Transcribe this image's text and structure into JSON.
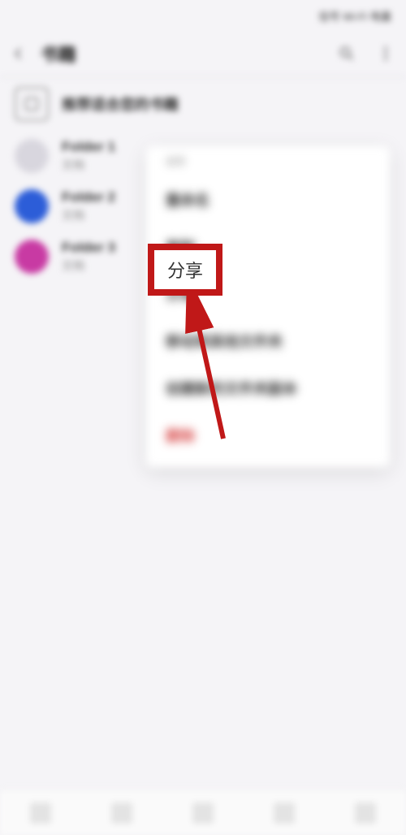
{
  "status": {
    "time_indicator": "",
    "right_icons": "信号 Wi-Fi 电量"
  },
  "header": {
    "title": "书籍"
  },
  "suggestion": {
    "text": "推荐适合您的书籍"
  },
  "list": [
    {
      "title": "Folder 1",
      "subtitle": "文档"
    },
    {
      "title": "Folder 2",
      "subtitle": "文档"
    },
    {
      "title": "Folder 3",
      "subtitle": "文档"
    }
  ],
  "context_menu": {
    "header": "选项",
    "items": [
      {
        "label": "重命名",
        "kind": "normal"
      },
      {
        "label": "复制",
        "kind": "normal"
      },
      {
        "label": "分享",
        "kind": "normal"
      },
      {
        "label": "移动到其他文件夹",
        "kind": "normal"
      },
      {
        "label": "创建新的文件夹副本",
        "kind": "normal"
      },
      {
        "label": "删除",
        "kind": "danger"
      }
    ]
  },
  "highlight": {
    "label": "分享"
  }
}
